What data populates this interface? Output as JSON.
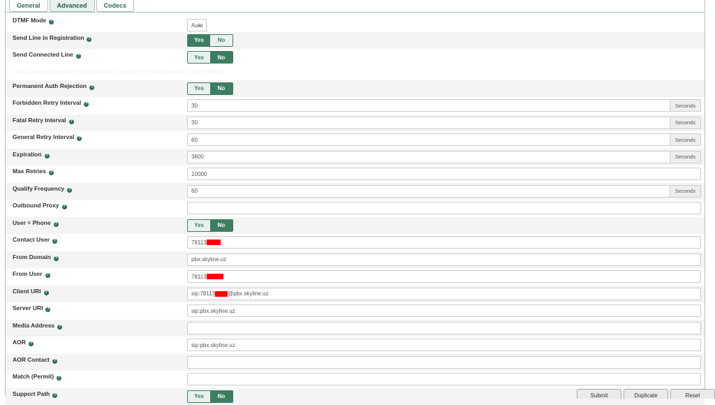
{
  "tabs": [
    {
      "label": "General",
      "active": false
    },
    {
      "label": "Advanced",
      "active": true
    },
    {
      "label": "Codecs",
      "active": false
    }
  ],
  "icons": {
    "help": "help-icon",
    "dropdown": "chevron-down-icon"
  },
  "colors": {
    "accent": "#3d7e62",
    "accent_light": "#e9f1ec",
    "redaction": "#ff0000"
  },
  "toggle_labels": {
    "yes": "Yes",
    "no": "No"
  },
  "fields": {
    "dtmf_mode": {
      "label": "DTMF Mode",
      "value": "Auto"
    },
    "send_line_in_registration": {
      "label": "Send Line in Registration",
      "selected": "Yes"
    },
    "send_connected_line": {
      "label": "Send Connected Line",
      "selected": "No"
    },
    "send_connected_line_note": "Send Connected line updates to this endpoint. If set to 'Yes' for some providers. False by default.",
    "permanent_auth_rejection": {
      "label": "Permanent Auth Rejection",
      "selected": "No"
    },
    "forbidden_retry_interval": {
      "label": "Forbidden Retry Interval",
      "value": "30",
      "unit": "Seconds"
    },
    "fatal_retry_interval": {
      "label": "Fatal Retry Interval",
      "value": "30",
      "unit": "Seconds"
    },
    "general_retry_interval": {
      "label": "General Retry Interval",
      "value": "60",
      "unit": "Seconds"
    },
    "expiration": {
      "label": "Expiration",
      "value": "3600",
      "unit": "Seconds"
    },
    "max_retries": {
      "label": "Max Retries",
      "value": "10000"
    },
    "qualify_frequency": {
      "label": "Qualify Frequency",
      "value": "60",
      "unit": "Seconds"
    },
    "outbound_proxy": {
      "label": "Outbound Proxy",
      "value": ""
    },
    "user_phone": {
      "label": "User = Phone",
      "selected": "No"
    },
    "contact_user": {
      "label": "Contact User",
      "value": "78113"
    },
    "from_domain": {
      "label": "From Domain",
      "value": "pbx.skyline.uz"
    },
    "from_user": {
      "label": "From User",
      "value": "78113"
    },
    "client_uri": {
      "label": "Client URI",
      "value_prefix": "sip:78113",
      "value_suffix": "@pbx.skyline.uz"
    },
    "server_uri": {
      "label": "Server URI",
      "value": "sip:pbx.skyline.uz"
    },
    "media_address": {
      "label": "Media Address",
      "value": ""
    },
    "aor": {
      "label": "AOR",
      "value": "sip:pbx.skyline.uz"
    },
    "aor_contact": {
      "label": "AOR Contact",
      "value": ""
    },
    "match_permit": {
      "label": "Match (Permit)",
      "value": ""
    },
    "support_path": {
      "label": "Support Path",
      "selected": "No"
    }
  },
  "footer_buttons": [
    "Submit",
    "Duplicate",
    "Reset"
  ]
}
